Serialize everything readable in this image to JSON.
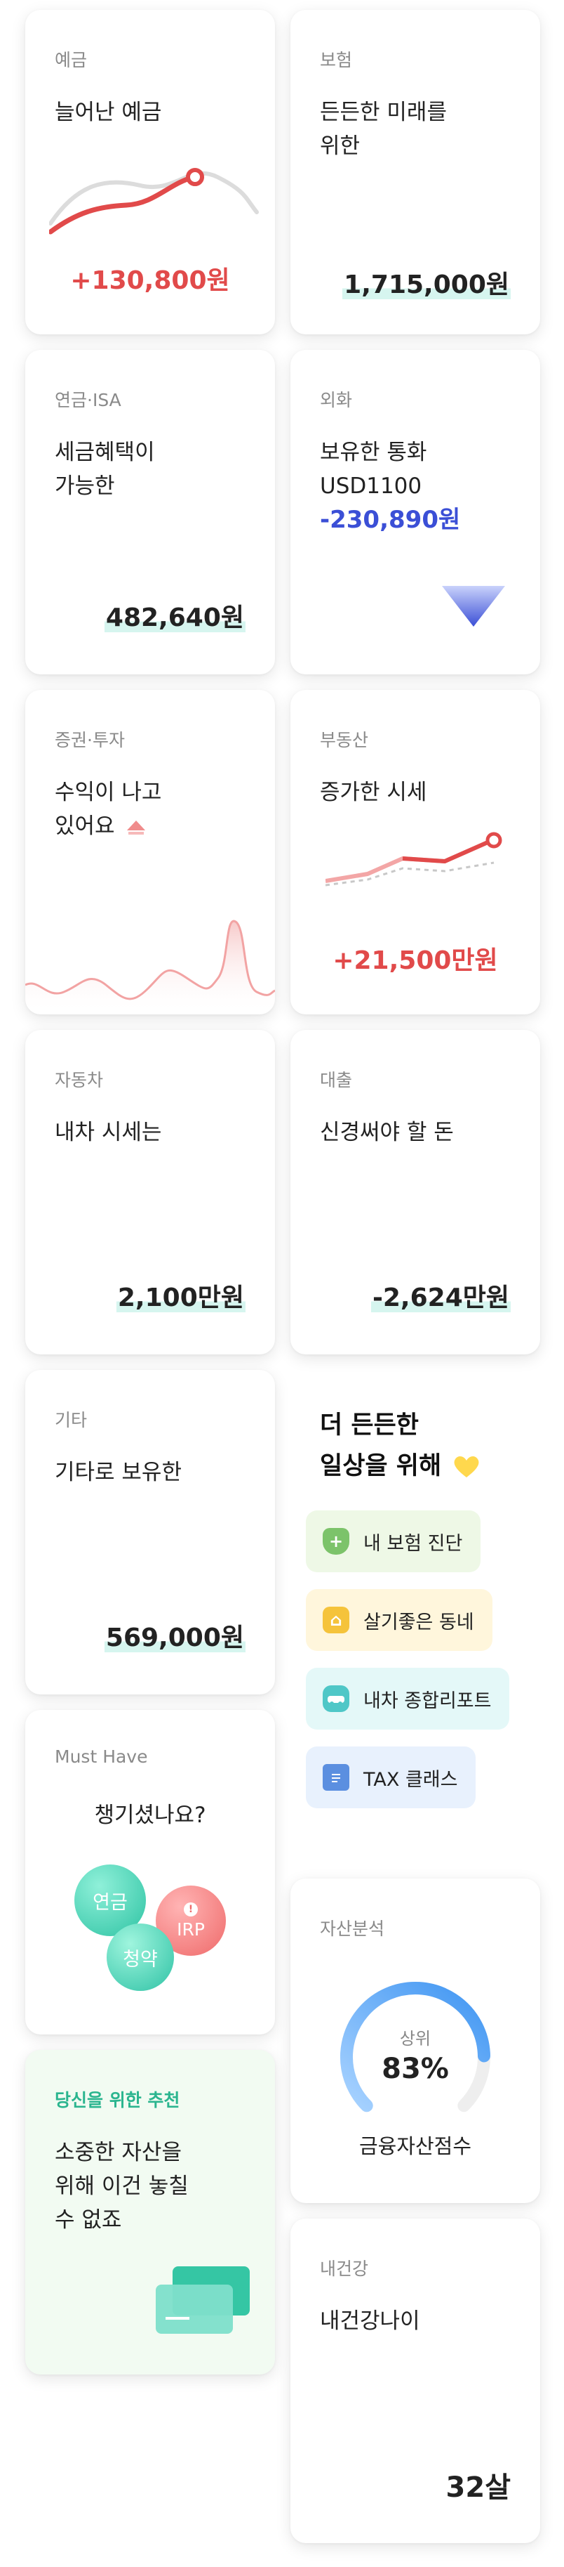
{
  "cards": {
    "deposit": {
      "category": "예금",
      "desc": "늘어난 예금",
      "amount": "+130,800원"
    },
    "insurance": {
      "category": "보험",
      "desc_line1": "든든한 미래를",
      "desc_line2": "위한",
      "amount": "1,715,000원"
    },
    "pension": {
      "category": "연금·ISA",
      "desc_line1": "세금혜택이",
      "desc_line2": "가능한",
      "amount": "482,640원"
    },
    "forex": {
      "category": "외화",
      "desc_line1": "보유한 통화",
      "desc_line2": "USD1100",
      "amount": "-230,890원"
    },
    "stock": {
      "category": "증권·투자",
      "desc_line1": "수익이 나고",
      "desc_line2": "있어요",
      "trend_icon": "up-arrow-icon"
    },
    "realestate": {
      "category": "부동산",
      "desc": "증가한 시세",
      "amount": "+21,500만원"
    },
    "car": {
      "category": "자동차",
      "desc": "내차 시세는",
      "amount": "2,100만원"
    },
    "loan": {
      "category": "대출",
      "desc": "신경써야 할 돈",
      "amount": "-2,624만원"
    },
    "etc": {
      "category": "기타",
      "desc": "기타로 보유한",
      "amount": "569,000원"
    },
    "musthave": {
      "category": "Must Have",
      "question": "챙기셨나요?",
      "bubbles": [
        "연금",
        "IRP",
        "청약"
      ]
    },
    "recommend": {
      "category": "당신을 위한 추천",
      "desc_line1": "소중한 자산을",
      "desc_line2": "위해 이건 놓칠",
      "desc_line3": "수 없죠"
    },
    "analysis": {
      "category": "자산분석",
      "rank_label": "상위",
      "percent": "83%",
      "score_label": "금융자산점수",
      "gauge_value": 0.83
    },
    "health": {
      "category": "내건강",
      "desc": "내건강나이",
      "age": "32살"
    }
  },
  "side": {
    "title_line1": "더 든든한",
    "title_line2": "일상을 위해",
    "title_icon": "yellow-heart-icon",
    "menu": [
      {
        "label": "내 보험 진단",
        "icon": "shield-plus-icon",
        "bg": "#eef8e6",
        "icon_color": "#7cc36a"
      },
      {
        "label": "살기좋은 동네",
        "icon": "house-icon",
        "bg": "#fff6dc",
        "icon_color": "#f5c33b"
      },
      {
        "label": "내차 종합리포트",
        "icon": "car-icon",
        "bg": "#e4f8f8",
        "icon_color": "#4fc7c7"
      },
      {
        "label": "TAX 클래스",
        "icon": "receipt-icon",
        "bg": "#e8f1fd",
        "icon_color": "#5b8fe0"
      }
    ]
  },
  "colors": {
    "accent_red": "#e14a4a",
    "accent_blue": "#3b4fd6",
    "highlight": "#d6f5ef"
  }
}
